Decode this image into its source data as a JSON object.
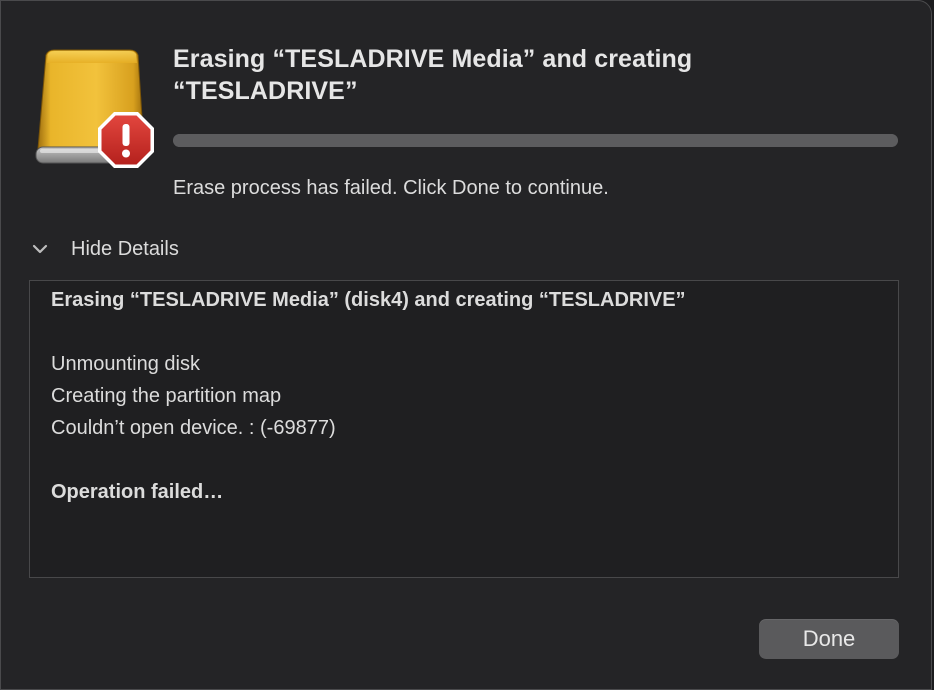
{
  "dialog": {
    "title": "Erasing “TESLADRIVE Media” and creating “TESLADRIVE”",
    "progress_fraction": 1.0,
    "status": "Erase process has failed. Click Done to continue.",
    "details_toggle_label": "Hide Details",
    "done_label": "Done"
  },
  "log": {
    "lines": [
      {
        "text": "Erasing “TESLADRIVE Media” (disk4) and creating “TESLADRIVE”",
        "bold": true
      },
      {
        "text": "",
        "bold": false
      },
      {
        "text": "Unmounting disk",
        "bold": false
      },
      {
        "text": "Creating the partition map",
        "bold": false
      },
      {
        "text": "Couldn’t open device. : (-69877)",
        "bold": false
      },
      {
        "text": "",
        "bold": false
      },
      {
        "text": "Operation failed…",
        "bold": true
      }
    ]
  },
  "icons": {
    "drive": "external-drive-icon",
    "alert": "alert-badge-icon",
    "disclosure": "chevron-down-icon"
  },
  "colors": {
    "drive_gold": "#e0a91c",
    "alert_red": "#c9302c",
    "background": "#242426"
  }
}
